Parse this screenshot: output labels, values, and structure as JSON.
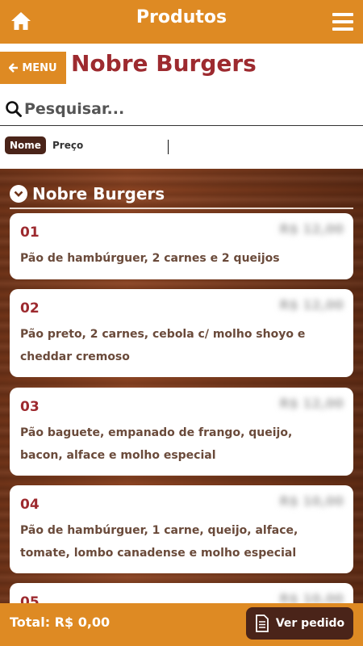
{
  "header": {
    "title": "Produtos",
    "home_icon": "home-icon",
    "menu_icon": "hamburger-menu-icon"
  },
  "restaurant": {
    "menu_label": "MENU",
    "name": "Nobre Burgers"
  },
  "search": {
    "placeholder": "Pesquisar..."
  },
  "sort": {
    "options": [
      "Nome",
      "Preço"
    ],
    "active": "Nome"
  },
  "category": {
    "name": "Nobre Burgers"
  },
  "products": [
    {
      "number": "01",
      "price": "R$ 12,00",
      "description": "Pão de hambúrguer, 2 carnes e 2 queijos"
    },
    {
      "number": "02",
      "price": "R$ 12,00",
      "description": "Pão preto, 2 carnes, cebola c/ molho shoyo e cheddar cremoso"
    },
    {
      "number": "03",
      "price": "R$ 12,00",
      "description": "Pão baguete, empanado de frango, queijo, bacon, alface e molho especial"
    },
    {
      "number": "04",
      "price": "R$ 10,00",
      "description": "Pão de hambúrguer, 1 carne, queijo, alface, tomate, lombo canadense e molho especial"
    },
    {
      "number": "05",
      "price": "R$ 10,00",
      "description": ""
    }
  ],
  "footer": {
    "total": "Total: R$ 0,00",
    "view_order": "Ver pedido"
  },
  "colors": {
    "accent": "#de8a23",
    "brand_red": "#9d2a2f",
    "dark_brown": "#4a2419"
  }
}
